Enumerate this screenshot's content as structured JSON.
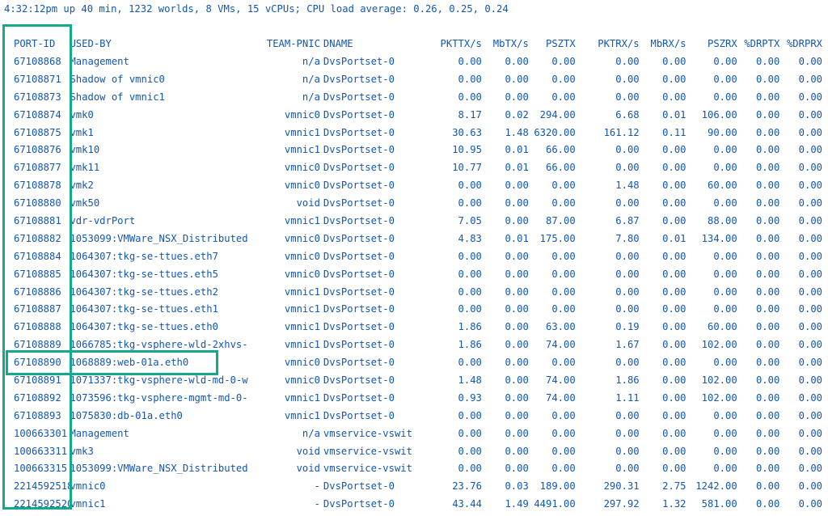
{
  "status_line": "4:32:12pm up 40 min, 1232 worlds, 8 VMs, 15 vCPUs; CPU load average: 0.26, 0.25, 0.24",
  "highlight_color": "#15a98b",
  "text_color": "#1357b0",
  "columns": [
    "PORT-ID",
    "USED-BY",
    "TEAM-PNIC",
    "DNAME",
    "PKTTX/s",
    "MbTX/s",
    "PSZTX",
    "PKTRX/s",
    "MbRX/s",
    "PSZRX",
    "%DRPTX",
    "%DRPRX"
  ],
  "rows": [
    [
      "67108868",
      "Management",
      "n/a",
      "DvsPortset-0",
      "0.00",
      "0.00",
      "0.00",
      "0.00",
      "0.00",
      "0.00",
      "0.00",
      "0.00"
    ],
    [
      "67108871",
      "Shadow of vmnic0",
      "n/a",
      "DvsPortset-0",
      "0.00",
      "0.00",
      "0.00",
      "0.00",
      "0.00",
      "0.00",
      "0.00",
      "0.00"
    ],
    [
      "67108873",
      "Shadow of vmnic1",
      "n/a",
      "DvsPortset-0",
      "0.00",
      "0.00",
      "0.00",
      "0.00",
      "0.00",
      "0.00",
      "0.00",
      "0.00"
    ],
    [
      "67108874",
      "vmk0",
      "vmnic0",
      "DvsPortset-0",
      "8.17",
      "0.02",
      "294.00",
      "6.68",
      "0.01",
      "106.00",
      "0.00",
      "0.00"
    ],
    [
      "67108875",
      "vmk1",
      "vmnic1",
      "DvsPortset-0",
      "30.63",
      "1.48",
      "6320.00",
      "161.12",
      "0.11",
      "90.00",
      "0.00",
      "0.00"
    ],
    [
      "67108876",
      "vmk10",
      "vmnic1",
      "DvsPortset-0",
      "10.95",
      "0.01",
      "66.00",
      "0.00",
      "0.00",
      "0.00",
      "0.00",
      "0.00"
    ],
    [
      "67108877",
      "vmk11",
      "vmnic0",
      "DvsPortset-0",
      "10.77",
      "0.01",
      "66.00",
      "0.00",
      "0.00",
      "0.00",
      "0.00",
      "0.00"
    ],
    [
      "67108878",
      "vmk2",
      "vmnic0",
      "DvsPortset-0",
      "0.00",
      "0.00",
      "0.00",
      "1.48",
      "0.00",
      "60.00",
      "0.00",
      "0.00"
    ],
    [
      "67108880",
      "vmk50",
      "void",
      "DvsPortset-0",
      "0.00",
      "0.00",
      "0.00",
      "0.00",
      "0.00",
      "0.00",
      "0.00",
      "0.00"
    ],
    [
      "67108881",
      "vdr-vdrPort",
      "vmnic1",
      "DvsPortset-0",
      "7.05",
      "0.00",
      "87.00",
      "6.87",
      "0.00",
      "88.00",
      "0.00",
      "0.00"
    ],
    [
      "67108882",
      "1053099:VMWare_NSX_Distributed",
      "vmnic0",
      "DvsPortset-0",
      "4.83",
      "0.01",
      "175.00",
      "7.80",
      "0.01",
      "134.00",
      "0.00",
      "0.00"
    ],
    [
      "67108884",
      "1064307:tkg-se-ttues.eth7",
      "vmnic0",
      "DvsPortset-0",
      "0.00",
      "0.00",
      "0.00",
      "0.00",
      "0.00",
      "0.00",
      "0.00",
      "0.00"
    ],
    [
      "67108885",
      "1064307:tkg-se-ttues.eth5",
      "vmnic0",
      "DvsPortset-0",
      "0.00",
      "0.00",
      "0.00",
      "0.00",
      "0.00",
      "0.00",
      "0.00",
      "0.00"
    ],
    [
      "67108886",
      "1064307:tkg-se-ttues.eth2",
      "vmnic1",
      "DvsPortset-0",
      "0.00",
      "0.00",
      "0.00",
      "0.00",
      "0.00",
      "0.00",
      "0.00",
      "0.00"
    ],
    [
      "67108887",
      "1064307:tkg-se-ttues.eth1",
      "vmnic1",
      "DvsPortset-0",
      "0.00",
      "0.00",
      "0.00",
      "0.00",
      "0.00",
      "0.00",
      "0.00",
      "0.00"
    ],
    [
      "67108888",
      "1064307:tkg-se-ttues.eth0",
      "vmnic1",
      "DvsPortset-0",
      "1.86",
      "0.00",
      "63.00",
      "0.19",
      "0.00",
      "60.00",
      "0.00",
      "0.00"
    ],
    [
      "67108889",
      "1066785:tkg-vsphere-wld-2xhvs-",
      "vmnic1",
      "DvsPortset-0",
      "1.86",
      "0.00",
      "74.00",
      "1.67",
      "0.00",
      "102.00",
      "0.00",
      "0.00"
    ],
    [
      "67108890",
      "1068889:web-01a.eth0",
      "vmnic0",
      "DvsPortset-0",
      "0.00",
      "0.00",
      "0.00",
      "0.00",
      "0.00",
      "0.00",
      "0.00",
      "0.00"
    ],
    [
      "67108891",
      "1071337:tkg-vsphere-wld-md-0-w",
      "vmnic0",
      "DvsPortset-0",
      "1.48",
      "0.00",
      "74.00",
      "1.86",
      "0.00",
      "102.00",
      "0.00",
      "0.00"
    ],
    [
      "67108892",
      "1073596:tkg-vsphere-mgmt-md-0-",
      "vmnic1",
      "DvsPortset-0",
      "0.93",
      "0.00",
      "74.00",
      "1.11",
      "0.00",
      "102.00",
      "0.00",
      "0.00"
    ],
    [
      "67108893",
      "1075830:db-01a.eth0",
      "vmnic1",
      "DvsPortset-0",
      "0.00",
      "0.00",
      "0.00",
      "0.00",
      "0.00",
      "0.00",
      "0.00",
      "0.00"
    ],
    [
      "100663301",
      "Management",
      "n/a",
      "vmservice-vswit",
      "0.00",
      "0.00",
      "0.00",
      "0.00",
      "0.00",
      "0.00",
      "0.00",
      "0.00"
    ],
    [
      "100663311",
      "vmk3",
      "void",
      "vmservice-vswit",
      "0.00",
      "0.00",
      "0.00",
      "0.00",
      "0.00",
      "0.00",
      "0.00",
      "0.00"
    ],
    [
      "100663315",
      "1053099:VMWare_NSX_Distributed",
      "void",
      "vmservice-vswit",
      "0.00",
      "0.00",
      "0.00",
      "0.00",
      "0.00",
      "0.00",
      "0.00",
      "0.00"
    ],
    [
      "2214592518",
      "vmnic0",
      "-",
      "DvsPortset-0",
      "23.76",
      "0.03",
      "189.00",
      "290.31",
      "2.75",
      "1242.00",
      "0.00",
      "0.00"
    ],
    [
      "2214592520",
      "vmnic1",
      "-",
      "DvsPortset-0",
      "43.44",
      "1.49",
      "4491.00",
      "297.92",
      "1.32",
      "581.00",
      "0.00",
      "0.00"
    ]
  ]
}
